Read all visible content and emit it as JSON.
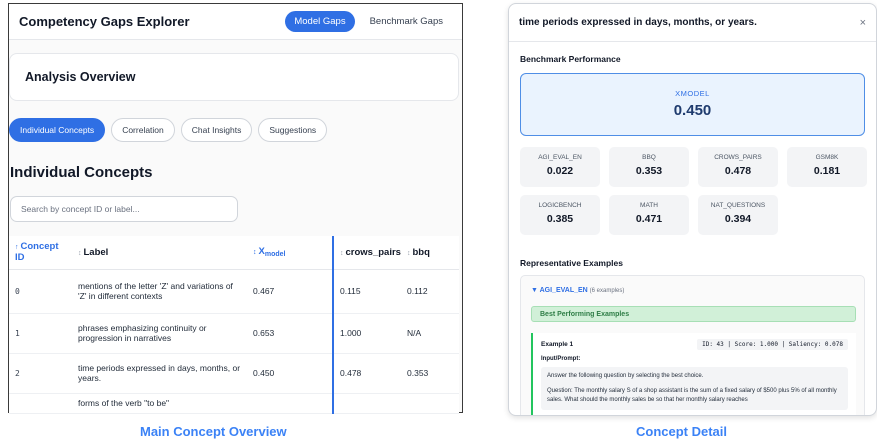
{
  "left": {
    "app_title": "Competency Gaps Explorer",
    "top_tabs": [
      {
        "label": "Model Gaps",
        "active": true
      },
      {
        "label": "Benchmark Gaps",
        "active": false
      }
    ],
    "overview_title": "Analysis Overview",
    "pills": [
      {
        "label": "Individual Concepts",
        "active": true
      },
      {
        "label": "Correlation",
        "active": false
      },
      {
        "label": "Chat Insights",
        "active": false
      },
      {
        "label": "Suggestions",
        "active": false
      }
    ],
    "section_title": "Individual Concepts",
    "search_placeholder": "Search by concept ID or label...",
    "table": {
      "headers": {
        "concept_id": "Concept ID",
        "label": "Label",
        "x_main": "X",
        "x_sub": "model",
        "crows_pairs": "crows_pairs",
        "bbq": "bbq"
      },
      "rows": [
        {
          "id": "0",
          "label": "mentions of the letter 'Z' and variations of 'Z' in different contexts",
          "x": "0.467",
          "crows": "0.115",
          "bbq": "0.112"
        },
        {
          "id": "1",
          "label": "phrases emphasizing continuity or progression in narratives",
          "x": "0.653",
          "crows": "1.000",
          "bbq": "N/A"
        },
        {
          "id": "2",
          "label": "time periods expressed in days, months, or years.",
          "x": "0.450",
          "crows": "0.478",
          "bbq": "0.353"
        },
        {
          "id": "",
          "label": "forms of the verb \"to be\"",
          "x": "",
          "crows": "",
          "bbq": ""
        }
      ]
    }
  },
  "right": {
    "title": "time periods expressed in days, months, or years.",
    "close": "×",
    "benchmark_heading": "Benchmark Performance",
    "xmodel_label": "XMODEL",
    "xmodel_value": "0.450",
    "benchmarks": [
      {
        "label": "AGI_EVAL_EN",
        "value": "0.022"
      },
      {
        "label": "BBQ",
        "value": "0.353"
      },
      {
        "label": "CROWS_PAIRS",
        "value": "0.478"
      },
      {
        "label": "GSM8K",
        "value": "0.181"
      },
      {
        "label": "LOGICBENCH",
        "value": "0.385"
      },
      {
        "label": "MATH",
        "value": "0.471"
      },
      {
        "label": "NAT_QUESTIONS",
        "value": "0.394"
      }
    ],
    "rep_heading": "Representative Examples",
    "agi_group": "▼ AGI_EVAL_EN",
    "agi_count": "(6 examples)",
    "best_label": "Best Performing Examples",
    "example": {
      "name": "Example 1",
      "meta": "ID: 43 | Score: 1.000 | Saliency: 0.078",
      "prompt_label": "Input/Prompt:",
      "text1": "Answer the following question by selecting the best choice.",
      "text2": "Question: The monthly salary S of a shop assistant is the sum of a fixed salary of $500 plus 5% of all monthly sales. What should the monthly sales be so that her monthly salary reaches"
    }
  },
  "captions": {
    "left": "Main Concept Overview",
    "right": "Concept Detail"
  }
}
